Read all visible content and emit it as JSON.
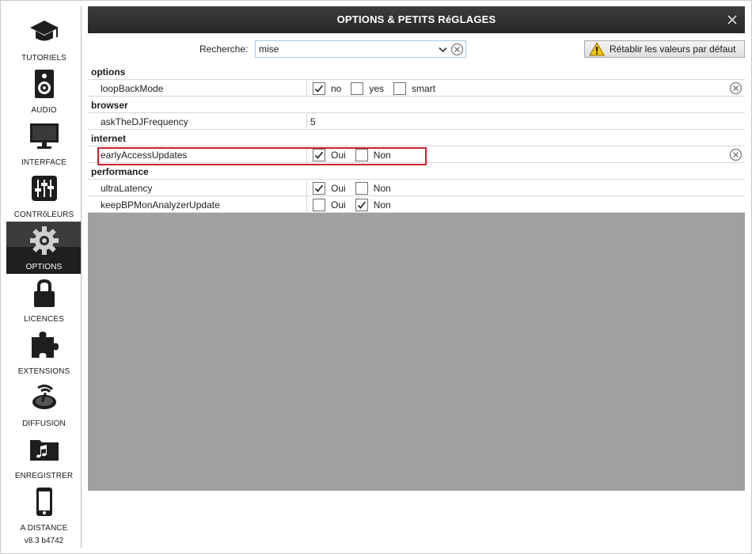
{
  "sidebar": {
    "items": [
      {
        "label": "TUTORIELS",
        "icon": "mortarboard-icon"
      },
      {
        "label": "AUDIO",
        "icon": "speaker-icon"
      },
      {
        "label": "INTERFACE",
        "icon": "monitor-icon"
      },
      {
        "label": "CONTRôLEURS",
        "icon": "sliders-icon"
      },
      {
        "label": "OPTIONS",
        "icon": "gear-icon",
        "active": true
      },
      {
        "label": "LICENCES",
        "icon": "lock-icon"
      },
      {
        "label": "EXTENSIONS",
        "icon": "puzzle-icon"
      },
      {
        "label": "DIFFUSION",
        "icon": "broadcast-icon"
      },
      {
        "label": "ENREGISTRER",
        "icon": "music-folder-icon"
      },
      {
        "label": "A DISTANCE",
        "icon": "phone-icon"
      }
    ],
    "version": "v8.3 b4742"
  },
  "window": {
    "title": "OPTIONS & PETITS RéGLAGES"
  },
  "search": {
    "label": "Recherche:",
    "value": "mise"
  },
  "reset_button": {
    "label": "Rétablir les valeurs par défaut"
  },
  "table": {
    "sections": [
      {
        "title": "options",
        "rows": [
          {
            "key": "loopBackMode",
            "options": [
              {
                "label": "no",
                "checked": true
              },
              {
                "label": "yes",
                "checked": false
              },
              {
                "label": "smart",
                "checked": false
              }
            ],
            "clearable": true
          }
        ]
      },
      {
        "title": "browser",
        "rows": [
          {
            "key": "askTheDJFrequency",
            "value": "5"
          }
        ]
      },
      {
        "title": "internet",
        "rows": [
          {
            "key": "earlyAccessUpdates",
            "options": [
              {
                "label": "Oui",
                "checked": true
              },
              {
                "label": "Non",
                "checked": false
              }
            ],
            "clearable": true,
            "highlighted": true
          }
        ]
      },
      {
        "title": "performance",
        "rows": [
          {
            "key": "ultraLatency",
            "options": [
              {
                "label": "Oui",
                "checked": true
              },
              {
                "label": "Non",
                "checked": false
              }
            ]
          },
          {
            "key": "keepBPMonAnalyzerUpdate",
            "options": [
              {
                "label": "Oui",
                "checked": false
              },
              {
                "label": "Non",
                "checked": true
              }
            ]
          }
        ]
      }
    ]
  },
  "colors": {
    "title_bar": "#2e2e2e",
    "sidebar_active": "#1f1f1f",
    "highlight": "#c8242f",
    "empty_area": "#a0a0a0"
  }
}
